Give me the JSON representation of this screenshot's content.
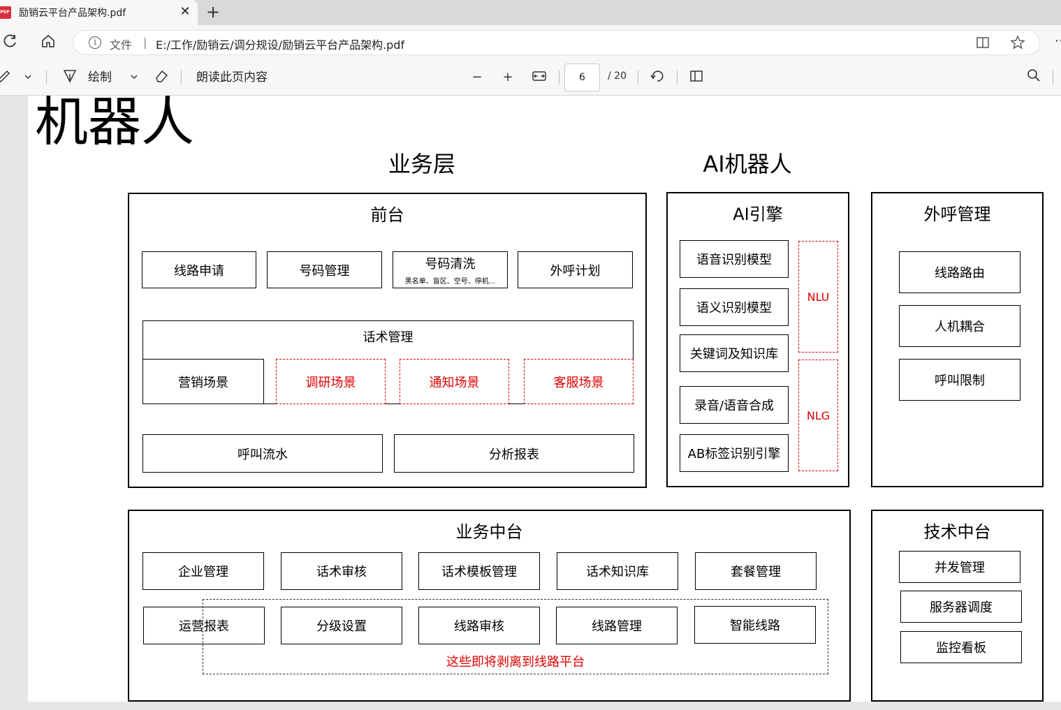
{
  "browser": {
    "tab": {
      "title": "励销云平台产品架构.pdf",
      "badge": "PDF",
      "close": "✕"
    },
    "new_tab": "+",
    "address": {
      "scheme_label": "文件",
      "separator": "|",
      "url": "E:/工作/励销云/调分规设/励销云平台产品架构.pdf"
    }
  },
  "pdf_toolbar": {
    "draw_label": "绘制",
    "read_aloud_label": "朗读此页内容",
    "page_current": "6",
    "page_total": "/ 20"
  },
  "slide": {
    "title": "机器人",
    "business_layer_title": "业务层",
    "ai_robot_title": "AI机器人",
    "front": {
      "title": "前台",
      "row1": [
        "线路申请",
        "号码管理",
        "号码清洗",
        "外呼计划"
      ],
      "number_clean_sub": "黑名单、盲区、空号、停机...",
      "script_mgmt_title": "话术管理",
      "scenes": [
        "营销场景",
        "调研场景",
        "通知场景",
        "客服场景"
      ],
      "row3": [
        "呼叫流水",
        "分析报表"
      ]
    },
    "ai_engine": {
      "title": "AI引擎",
      "items": [
        "语音识别模型",
        "语义识别模型",
        "关键词及知识库",
        "录音/语音合成",
        "AB标签识别引擎"
      ],
      "nlu": "NLU",
      "nlg": "NLG"
    },
    "outbound": {
      "title": "外呼管理",
      "items": [
        "线路路由",
        "人机耦合",
        "呼叫限制"
      ]
    },
    "biz_middle": {
      "title": "业务中台",
      "row1": [
        "企业管理",
        "话术审核",
        "话术模板管理",
        "话术知识库",
        "套餐管理"
      ],
      "row2": [
        "运营报表",
        "分级设置",
        "线路审核",
        "线路管理",
        "智能线路"
      ],
      "note": "这些即将剥离到线路平台"
    },
    "tech_middle": {
      "title": "技术中台",
      "items": [
        "并发管理",
        "服务器调度",
        "监控看板"
      ]
    }
  }
}
